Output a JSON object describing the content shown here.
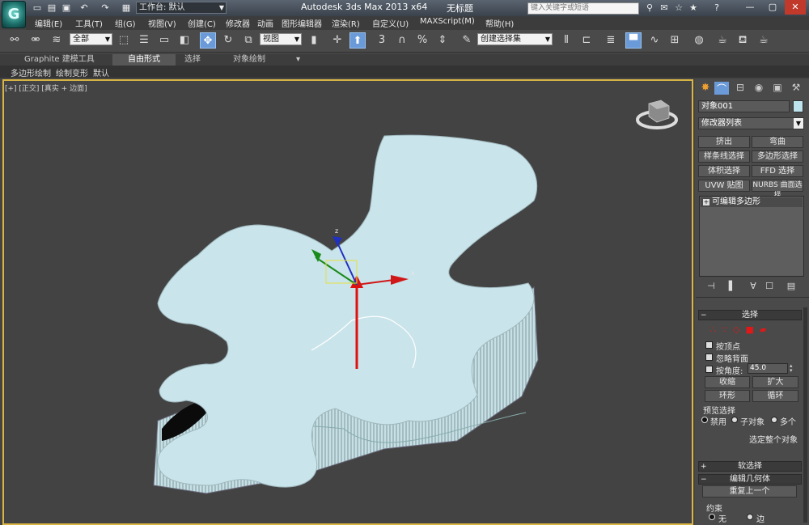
{
  "title": {
    "app": "Autodesk 3ds Max  2013 x64",
    "document": "无标题",
    "workspace": "工作台: 默认",
    "search_placeholder": "键入关键字或短语"
  },
  "menu": [
    "编辑(E)",
    "工具(T)",
    "组(G)",
    "视图(V)",
    "创建(C)",
    "修改器",
    "动画",
    "图形编辑器",
    "渲染(R)",
    "自定义(U)",
    "MAXScript(M)",
    "帮助(H)"
  ],
  "toolbar": {
    "selection_filter": "全部",
    "reference_coord": "视图",
    "named_selection": "创建选择集",
    "snap_label": "3"
  },
  "ribbon": {
    "tabs": [
      "Graphite 建模工具",
      "自由形式",
      "选择",
      "对象绘制"
    ],
    "active_tab": "自由形式",
    "subtabs": [
      "多边形绘制",
      "绘制变形",
      "默认"
    ]
  },
  "viewport": {
    "label": "[+] [正交] [真实 + 边面]",
    "colors": {
      "frame": "#d8b545",
      "object": "#c9e4ea",
      "background": "#434343"
    }
  },
  "command_panel": {
    "object_name": "对象001",
    "modifier_list": "修改器列表",
    "modifier_buttons": [
      "挤出",
      "弯曲",
      "样条线选择",
      "多边形选择",
      "体积选择",
      "FFD 选择",
      "UVW 贴图",
      "NURBS 曲面选择"
    ],
    "stack_item": "可编辑多边形",
    "selection_rollout": {
      "title": "选择",
      "by_vertex": "按顶点",
      "ignore_backfacing": "忽略背面",
      "by_angle": "按角度:",
      "angle_value": "45.0",
      "shrink": "收缩",
      "grow": "扩大",
      "ring": "环形",
      "loop": "循环",
      "preview_title": "预览选择",
      "preview_options": [
        "禁用",
        "子对象",
        "多个"
      ],
      "select_whole": "选定整个对象"
    },
    "soft_selection": "软选择",
    "edit_geometry": "编辑几何体",
    "repeat_last": "重复上一个",
    "constraints": "约束",
    "constraint_options": [
      "无",
      "边"
    ]
  }
}
